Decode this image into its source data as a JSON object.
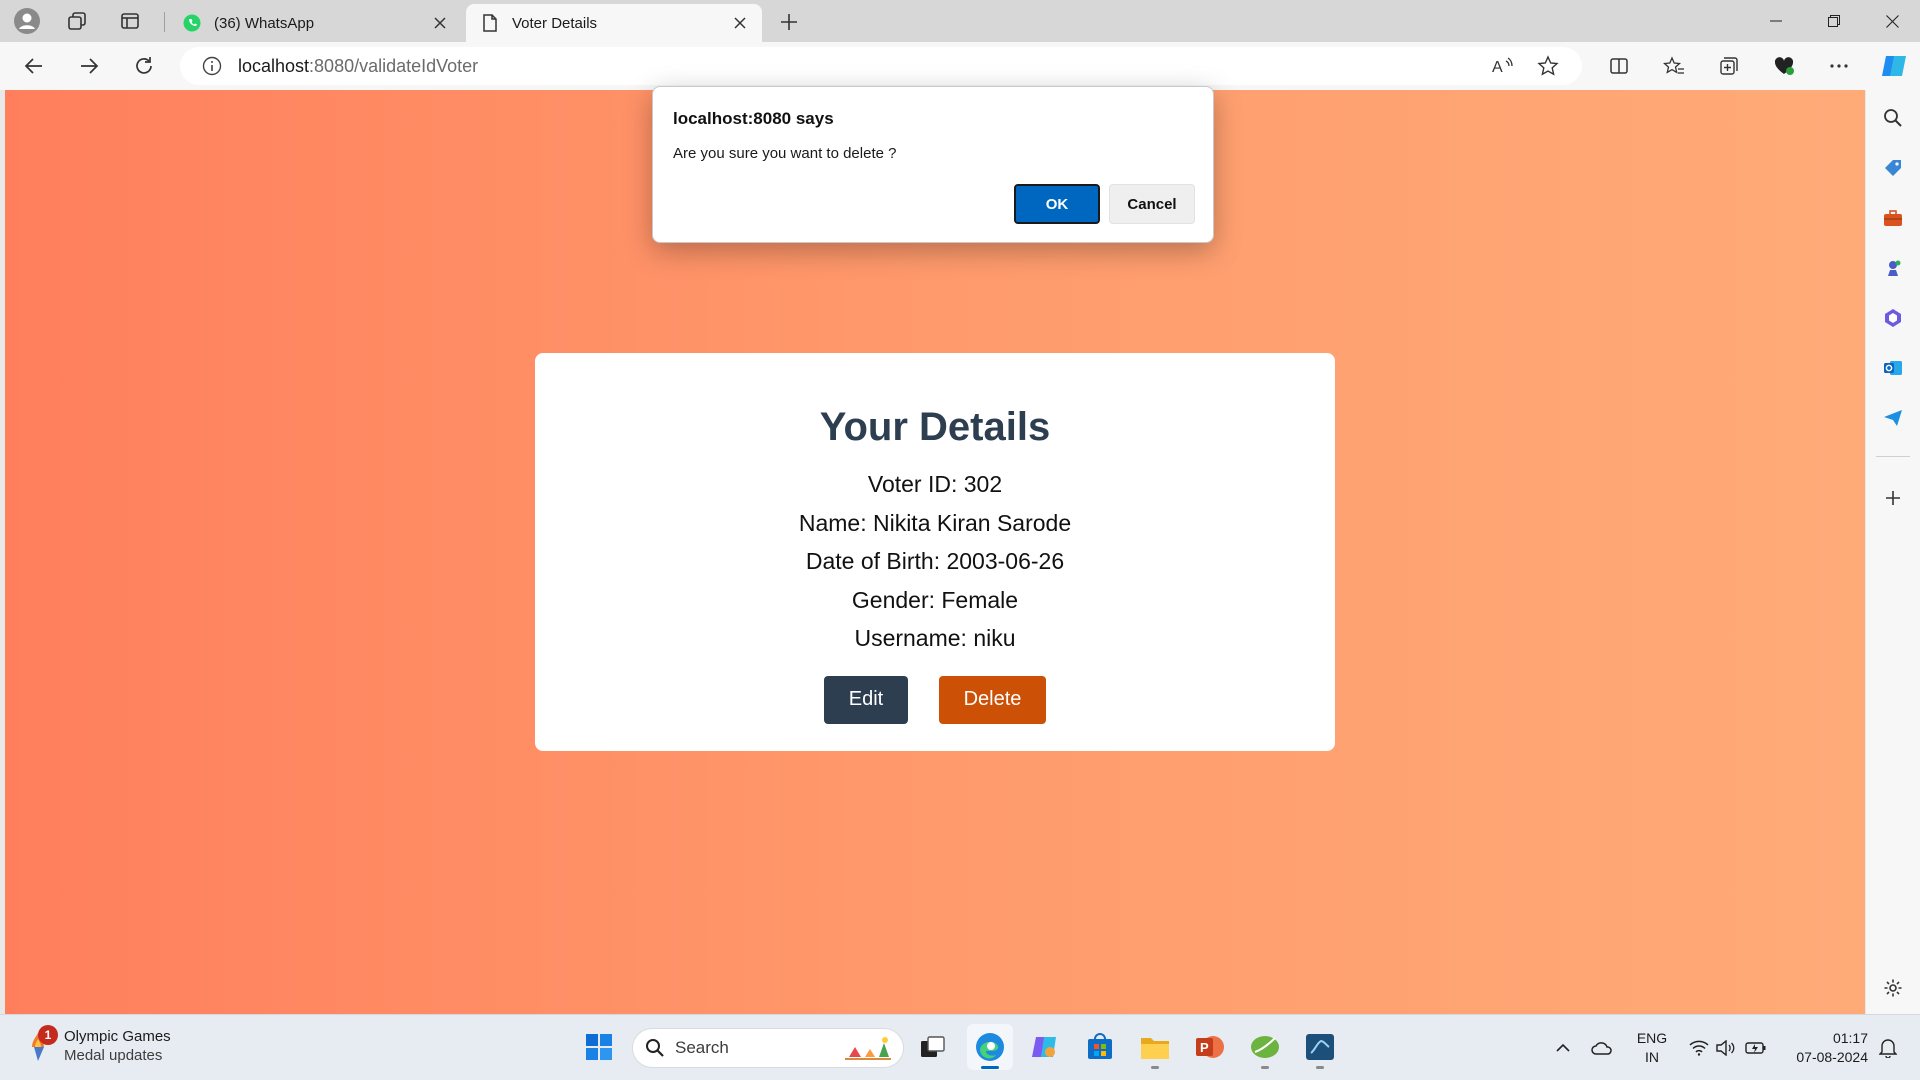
{
  "browser": {
    "tabs": [
      {
        "title": "(36) WhatsApp",
        "icon": "whatsapp-icon",
        "active": false
      },
      {
        "title": "Voter Details",
        "icon": "page-icon",
        "active": true
      }
    ],
    "address": {
      "host": "localhost",
      "path": ":8080/validateIdVoter"
    }
  },
  "dialog": {
    "title": "localhost:8080 says",
    "message": "Are you sure you want to delete ?",
    "ok_label": "OK",
    "cancel_label": "Cancel"
  },
  "card": {
    "title": "Your Details",
    "voter_id": "Voter ID: 302",
    "name": "Name: Nikita Kiran Sarode",
    "dob": "Date of Birth: 2003-06-26",
    "gender": "Gender: Female",
    "username": "Username: niku",
    "edit_label": "Edit",
    "delete_label": "Delete"
  },
  "colors": {
    "gradient_start": "#ff7f5c",
    "gradient_end": "#ffab78",
    "edit_button": "#2c3e50",
    "delete_button": "#cc5006",
    "ok_button": "#0067c0"
  },
  "taskbar": {
    "weather_badge": "1",
    "weather_title": "Olympic Games",
    "weather_sub": "Medal updates",
    "search_placeholder": "Search",
    "lang_line1": "ENG",
    "lang_line2": "IN",
    "time": "01:17",
    "date": "07-08-2024"
  }
}
